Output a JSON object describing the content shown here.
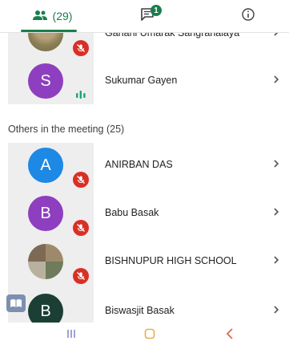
{
  "tabs": {
    "people_count": "(29)",
    "chat_badge": "1",
    "people_icon": "people-icon",
    "chat_icon": "chat-icon",
    "info_icon": "info-icon"
  },
  "participants_top": [
    {
      "name": "Gahani Umarak Sangrahalaya",
      "avatar": "photo",
      "status": "muted"
    },
    {
      "name": "Sukumar Gayen",
      "initial": "S",
      "avatar_color": "#8e3fbf",
      "status": "speaking"
    }
  ],
  "section_title": "Others in the meeting (25)",
  "participants_others": [
    {
      "name": "ANIRBAN DAS",
      "initial": "A",
      "avatar_color": "#1e88e5",
      "status": "muted"
    },
    {
      "name": "Babu Basak",
      "initial": "B",
      "avatar_color": "#8e3fbf",
      "status": "muted"
    },
    {
      "name": "BISHNUPUR HIGH SCHOOL",
      "avatar": "photo",
      "status": "muted"
    },
    {
      "name": "Biswasjit Basak",
      "initial": "B",
      "avatar_color": "#1c3f35",
      "status": "none"
    }
  ],
  "colors": {
    "accent": "#1a7f4b",
    "mute": "#d93025",
    "tile": "#eeeeee"
  },
  "navbar": {
    "recent_icon": "recent-apps-icon",
    "home_icon": "home-icon",
    "back_icon": "back-icon"
  }
}
